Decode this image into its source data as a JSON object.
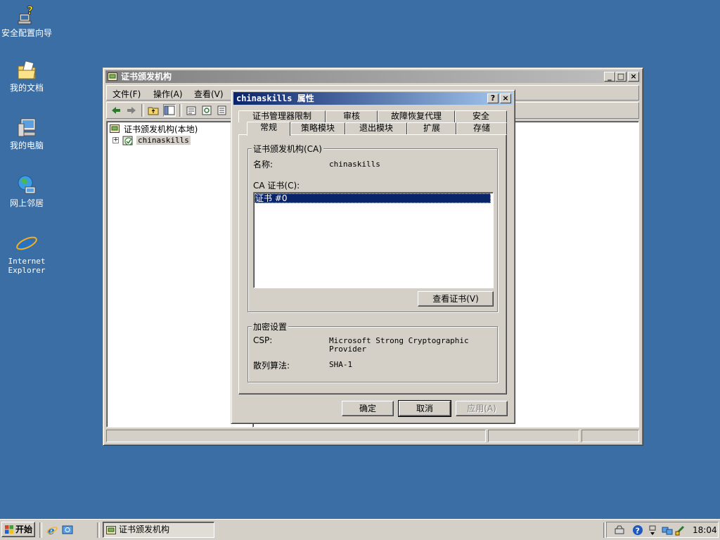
{
  "desktop": {
    "icons": [
      {
        "label": "安全配置向导"
      },
      {
        "label": "我的文档"
      },
      {
        "label": "我的电脑"
      },
      {
        "label": "网上邻居"
      },
      {
        "label": "Internet Explorer",
        "label_line1": "Internet",
        "label_line2": "Explorer"
      }
    ]
  },
  "mmc": {
    "title": "证书颁发机构",
    "menu": [
      "文件(F)",
      "操作(A)",
      "查看(V)"
    ],
    "tree": {
      "root": "证书颁发机构(本地)",
      "child": "chinaskills"
    }
  },
  "dialog": {
    "title": "chinaskills 属性",
    "tabs_row1": [
      "证书管理器限制",
      "审核",
      "故障恢复代理",
      "安全"
    ],
    "tabs_row2": [
      "常规",
      "策略模块",
      "退出模块",
      "扩展",
      "存储"
    ],
    "active_tab": "常规",
    "ca_group": {
      "legend": "证书颁发机构(CA)",
      "name_label": "名称:",
      "name_value": "chinaskills",
      "cert_label": "CA 证书(C):",
      "certs": [
        "证书 #0"
      ],
      "view_cert_button": "查看证书(V)"
    },
    "crypto_group": {
      "legend": "加密设置",
      "csp_label": "CSP:",
      "csp_value_line1": "Microsoft Strong Cryptographic",
      "csp_value_line2": "Provider",
      "hash_label": "散列算法:",
      "hash_value": "SHA-1"
    },
    "buttons": {
      "ok": "确定",
      "cancel": "取消",
      "apply": "应用(A)"
    }
  },
  "taskbar": {
    "start": "开始",
    "task": "证书颁发机构",
    "clock": "18:04"
  },
  "colors": {
    "desktop": "#3a6ea5",
    "title_active": "#0a246a",
    "title_inactive": "#808080",
    "face": "#d4d0c8",
    "selection": "#0a246a"
  }
}
